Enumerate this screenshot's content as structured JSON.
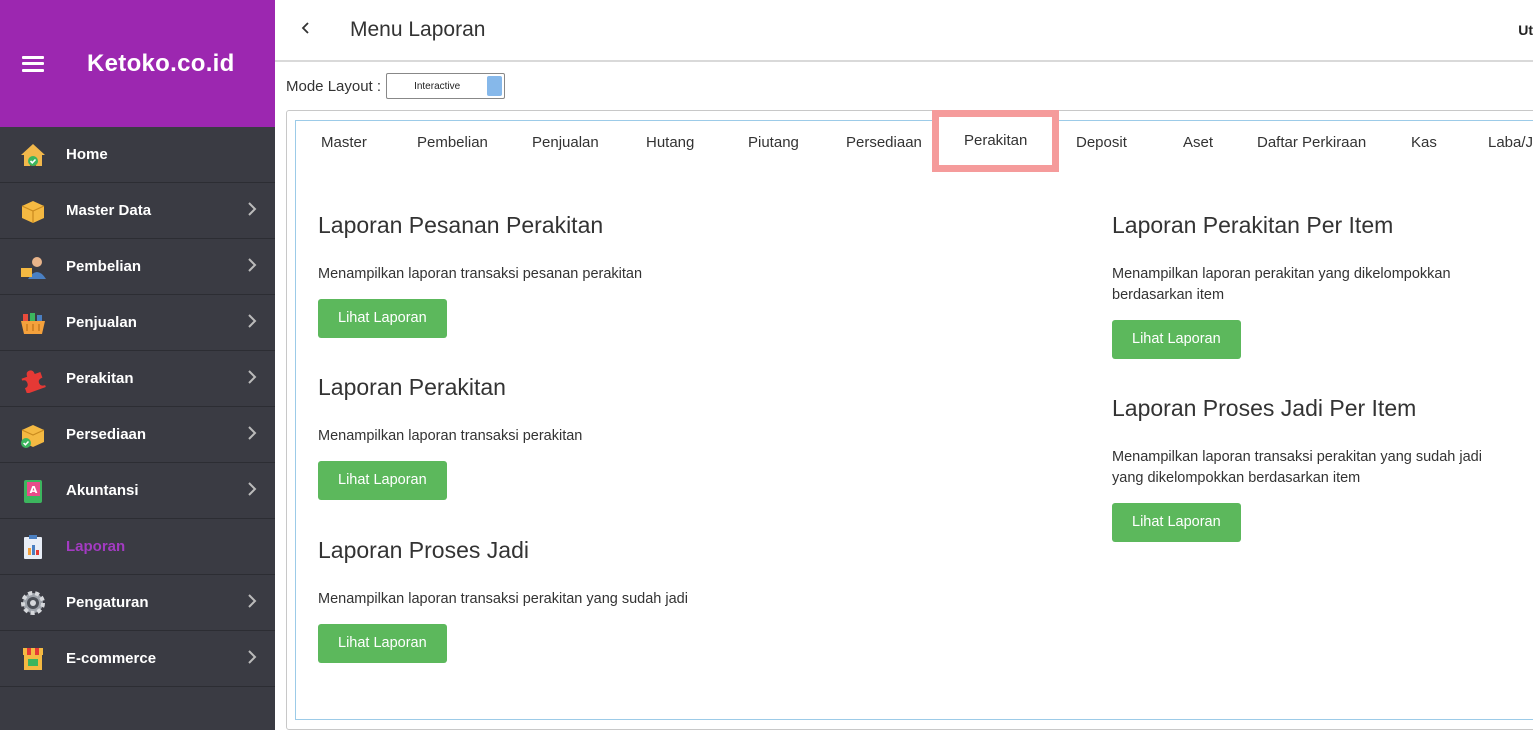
{
  "app": {
    "brand": "Ketoko.co.id",
    "page_title": "Menu Laporan",
    "user_fragment": "Ut"
  },
  "sidebar": {
    "items": [
      {
        "label": "Home",
        "icon": "home-icon",
        "has_chevron": false,
        "active": false
      },
      {
        "label": "Master Data",
        "icon": "box-icon",
        "has_chevron": true,
        "active": false
      },
      {
        "label": "Pembelian",
        "icon": "buyer-icon",
        "has_chevron": true,
        "active": false
      },
      {
        "label": "Penjualan",
        "icon": "basket-icon",
        "has_chevron": true,
        "active": false
      },
      {
        "label": "Perakitan",
        "icon": "puzzle-icon",
        "has_chevron": true,
        "active": false
      },
      {
        "label": "Persediaan",
        "icon": "box-check-icon",
        "has_chevron": true,
        "active": false
      },
      {
        "label": "Akuntansi",
        "icon": "book-icon",
        "has_chevron": true,
        "active": false
      },
      {
        "label": "Laporan",
        "icon": "clipboard-icon",
        "has_chevron": false,
        "active": true
      },
      {
        "label": "Pengaturan",
        "icon": "gear-icon",
        "has_chevron": true,
        "active": false
      },
      {
        "label": "E-commerce",
        "icon": "store-icon",
        "has_chevron": true,
        "active": false
      }
    ]
  },
  "mode": {
    "label": "Mode Layout :",
    "value": "Interactive"
  },
  "tabs": [
    "Master",
    "Pembelian",
    "Penjualan",
    "Hutang",
    "Piutang",
    "Persediaan",
    "Perakitan",
    "Deposit",
    "Aset",
    "Daftar Perkiraan",
    "Kas",
    "Laba/J"
  ],
  "selected_tab": "Perakitan",
  "button_label": "Lihat Laporan",
  "reports": {
    "left": [
      {
        "title": "Laporan Pesanan Perakitan",
        "desc": "Menampilkan laporan transaksi pesanan perakitan"
      },
      {
        "title": "Laporan Perakitan",
        "desc": "Menampilkan laporan transaksi perakitan"
      },
      {
        "title": "Laporan Proses Jadi",
        "desc": "Menampilkan laporan transaksi perakitan yang sudah jadi"
      }
    ],
    "right": [
      {
        "title": "Laporan Perakitan Per Item",
        "desc": "Menampilkan laporan perakitan yang dikelompokkan berdasarkan item"
      },
      {
        "title": "Laporan Proses Jadi Per Item",
        "desc": "Menampilkan laporan transaksi perakitan yang sudah jadi yang dikelompokkan berdasarkan item"
      }
    ]
  },
  "colors": {
    "brand": "#9c27b0",
    "sidebar_bg": "#3a3b43",
    "active_label": "#a33bc2",
    "button": "#5cb85c",
    "tab_highlight": "#f59b9b"
  }
}
